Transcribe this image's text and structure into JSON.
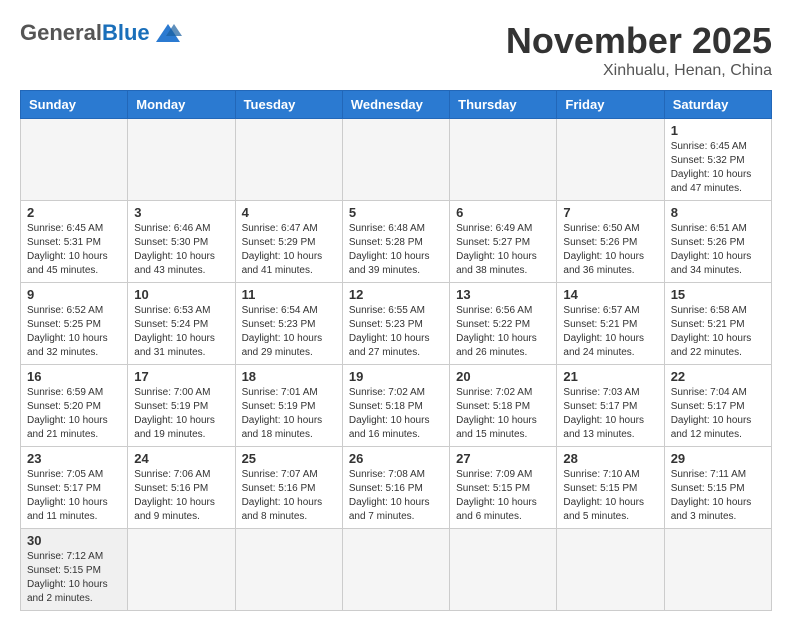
{
  "logo": {
    "general": "General",
    "blue": "Blue"
  },
  "header": {
    "month": "November 2025",
    "location": "Xinhualu, Henan, China"
  },
  "days_of_week": [
    "Sunday",
    "Monday",
    "Tuesday",
    "Wednesday",
    "Thursday",
    "Friday",
    "Saturday"
  ],
  "weeks": [
    [
      {
        "day": "",
        "info": ""
      },
      {
        "day": "",
        "info": ""
      },
      {
        "day": "",
        "info": ""
      },
      {
        "day": "",
        "info": ""
      },
      {
        "day": "",
        "info": ""
      },
      {
        "day": "",
        "info": ""
      },
      {
        "day": "1",
        "info": "Sunrise: 6:45 AM\nSunset: 5:32 PM\nDaylight: 10 hours and 47 minutes."
      }
    ],
    [
      {
        "day": "2",
        "info": "Sunrise: 6:45 AM\nSunset: 5:31 PM\nDaylight: 10 hours and 45 minutes."
      },
      {
        "day": "3",
        "info": "Sunrise: 6:46 AM\nSunset: 5:30 PM\nDaylight: 10 hours and 43 minutes."
      },
      {
        "day": "4",
        "info": "Sunrise: 6:47 AM\nSunset: 5:29 PM\nDaylight: 10 hours and 41 minutes."
      },
      {
        "day": "5",
        "info": "Sunrise: 6:48 AM\nSunset: 5:28 PM\nDaylight: 10 hours and 39 minutes."
      },
      {
        "day": "6",
        "info": "Sunrise: 6:49 AM\nSunset: 5:27 PM\nDaylight: 10 hours and 38 minutes."
      },
      {
        "day": "7",
        "info": "Sunrise: 6:50 AM\nSunset: 5:26 PM\nDaylight: 10 hours and 36 minutes."
      },
      {
        "day": "8",
        "info": "Sunrise: 6:51 AM\nSunset: 5:26 PM\nDaylight: 10 hours and 34 minutes."
      }
    ],
    [
      {
        "day": "9",
        "info": "Sunrise: 6:52 AM\nSunset: 5:25 PM\nDaylight: 10 hours and 32 minutes."
      },
      {
        "day": "10",
        "info": "Sunrise: 6:53 AM\nSunset: 5:24 PM\nDaylight: 10 hours and 31 minutes."
      },
      {
        "day": "11",
        "info": "Sunrise: 6:54 AM\nSunset: 5:23 PM\nDaylight: 10 hours and 29 minutes."
      },
      {
        "day": "12",
        "info": "Sunrise: 6:55 AM\nSunset: 5:23 PM\nDaylight: 10 hours and 27 minutes."
      },
      {
        "day": "13",
        "info": "Sunrise: 6:56 AM\nSunset: 5:22 PM\nDaylight: 10 hours and 26 minutes."
      },
      {
        "day": "14",
        "info": "Sunrise: 6:57 AM\nSunset: 5:21 PM\nDaylight: 10 hours and 24 minutes."
      },
      {
        "day": "15",
        "info": "Sunrise: 6:58 AM\nSunset: 5:21 PM\nDaylight: 10 hours and 22 minutes."
      }
    ],
    [
      {
        "day": "16",
        "info": "Sunrise: 6:59 AM\nSunset: 5:20 PM\nDaylight: 10 hours and 21 minutes."
      },
      {
        "day": "17",
        "info": "Sunrise: 7:00 AM\nSunset: 5:19 PM\nDaylight: 10 hours and 19 minutes."
      },
      {
        "day": "18",
        "info": "Sunrise: 7:01 AM\nSunset: 5:19 PM\nDaylight: 10 hours and 18 minutes."
      },
      {
        "day": "19",
        "info": "Sunrise: 7:02 AM\nSunset: 5:18 PM\nDaylight: 10 hours and 16 minutes."
      },
      {
        "day": "20",
        "info": "Sunrise: 7:02 AM\nSunset: 5:18 PM\nDaylight: 10 hours and 15 minutes."
      },
      {
        "day": "21",
        "info": "Sunrise: 7:03 AM\nSunset: 5:17 PM\nDaylight: 10 hours and 13 minutes."
      },
      {
        "day": "22",
        "info": "Sunrise: 7:04 AM\nSunset: 5:17 PM\nDaylight: 10 hours and 12 minutes."
      }
    ],
    [
      {
        "day": "23",
        "info": "Sunrise: 7:05 AM\nSunset: 5:17 PM\nDaylight: 10 hours and 11 minutes."
      },
      {
        "day": "24",
        "info": "Sunrise: 7:06 AM\nSunset: 5:16 PM\nDaylight: 10 hours and 9 minutes."
      },
      {
        "day": "25",
        "info": "Sunrise: 7:07 AM\nSunset: 5:16 PM\nDaylight: 10 hours and 8 minutes."
      },
      {
        "day": "26",
        "info": "Sunrise: 7:08 AM\nSunset: 5:16 PM\nDaylight: 10 hours and 7 minutes."
      },
      {
        "day": "27",
        "info": "Sunrise: 7:09 AM\nSunset: 5:15 PM\nDaylight: 10 hours and 6 minutes."
      },
      {
        "day": "28",
        "info": "Sunrise: 7:10 AM\nSunset: 5:15 PM\nDaylight: 10 hours and 5 minutes."
      },
      {
        "day": "29",
        "info": "Sunrise: 7:11 AM\nSunset: 5:15 PM\nDaylight: 10 hours and 3 minutes."
      }
    ],
    [
      {
        "day": "30",
        "info": "Sunrise: 7:12 AM\nSunset: 5:15 PM\nDaylight: 10 hours and 2 minutes."
      },
      {
        "day": "",
        "info": ""
      },
      {
        "day": "",
        "info": ""
      },
      {
        "day": "",
        "info": ""
      },
      {
        "day": "",
        "info": ""
      },
      {
        "day": "",
        "info": ""
      },
      {
        "day": "",
        "info": ""
      }
    ]
  ]
}
